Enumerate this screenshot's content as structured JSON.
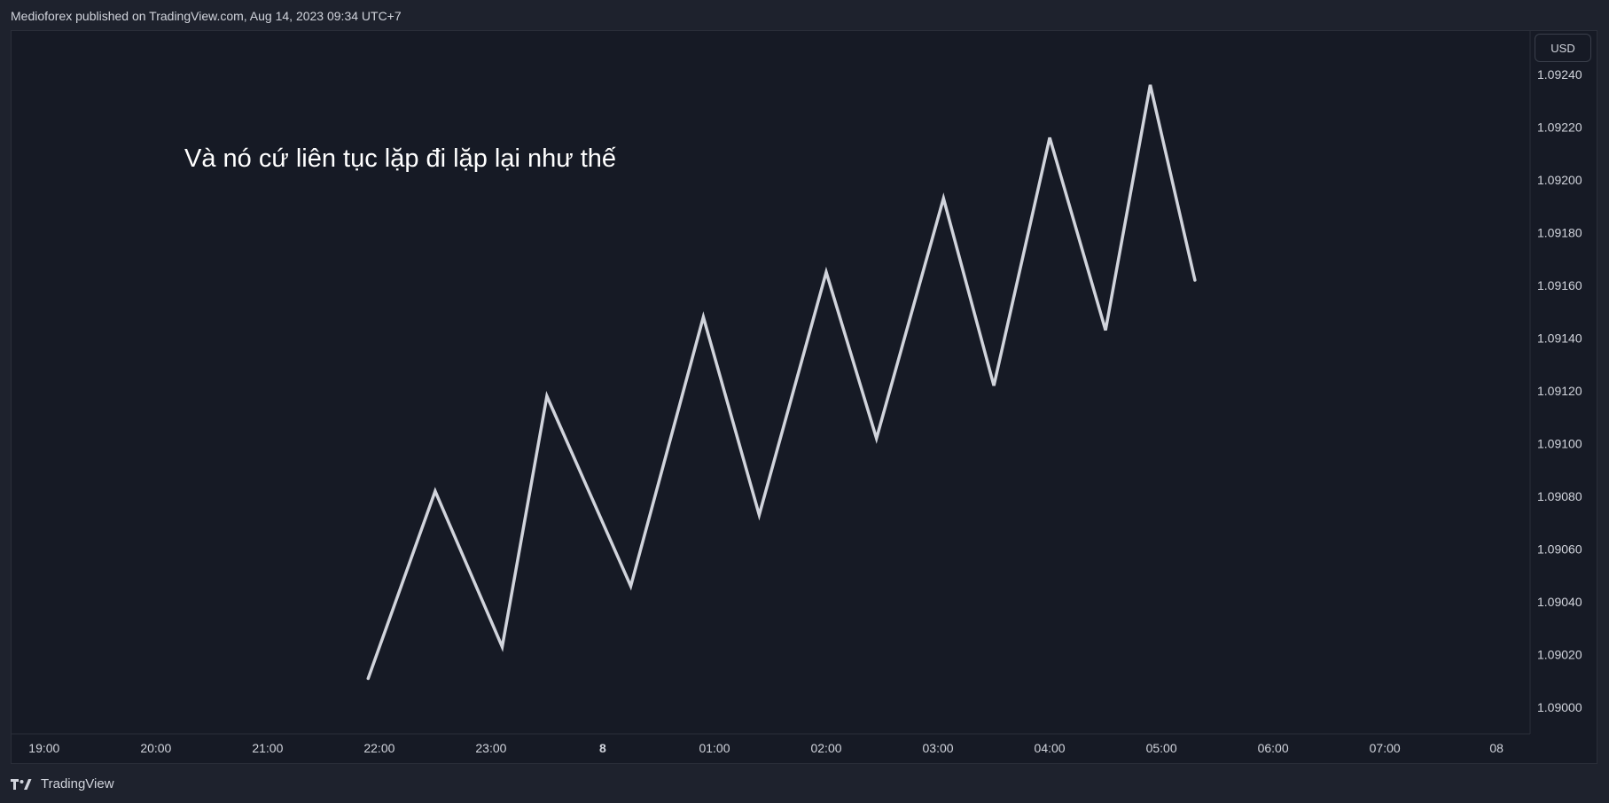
{
  "header": {
    "published_text": "Medioforex published on TradingView.com, Aug 14, 2023 09:34 UTC+7"
  },
  "price_scale": {
    "currency_button": "USD"
  },
  "footer": {
    "brand_label": "TradingView",
    "logo_icon": "tradingview-logo-icon"
  },
  "colors": {
    "background": "#161a25",
    "frame": "#1e222d",
    "line": "#d1d4dc",
    "text": "#d1d4dc"
  },
  "chart_data": {
    "type": "line",
    "annotation": "Và nó cứ liên tục lặp đi lặp lại như thế",
    "x_ticks": [
      "19:00",
      "20:00",
      "21:00",
      "22:00",
      "23:00",
      "8",
      "01:00",
      "02:00",
      "03:00",
      "04:00",
      "05:00",
      "06:00",
      "07:00",
      "08"
    ],
    "y_ticks": [
      "1.09000",
      "1.09020",
      "1.09040",
      "1.09060",
      "1.09080",
      "1.09100",
      "1.09120",
      "1.09140",
      "1.09160",
      "1.09180",
      "1.09200",
      "1.09220",
      "1.09240"
    ],
    "ylim": [
      1.0899,
      1.09244
    ],
    "x_range_hours": [
      18.7,
      32.3
    ],
    "series": [
      {
        "points": [
          {
            "x": 21.9,
            "y": 1.09011
          },
          {
            "x": 22.5,
            "y": 1.09082
          },
          {
            "x": 23.1,
            "y": 1.09023
          },
          {
            "x": 23.5,
            "y": 1.09118
          },
          {
            "x": 24.25,
            "y": 1.09046
          },
          {
            "x": 24.9,
            "y": 1.09148
          },
          {
            "x": 25.4,
            "y": 1.09073
          },
          {
            "x": 26.0,
            "y": 1.09165
          },
          {
            "x": 26.45,
            "y": 1.09102
          },
          {
            "x": 27.05,
            "y": 1.09193
          },
          {
            "x": 27.5,
            "y": 1.09122
          },
          {
            "x": 28.0,
            "y": 1.09216
          },
          {
            "x": 28.5,
            "y": 1.09143
          },
          {
            "x": 28.9,
            "y": 1.09236
          },
          {
            "x": 29.3,
            "y": 1.09162
          }
        ]
      }
    ]
  }
}
